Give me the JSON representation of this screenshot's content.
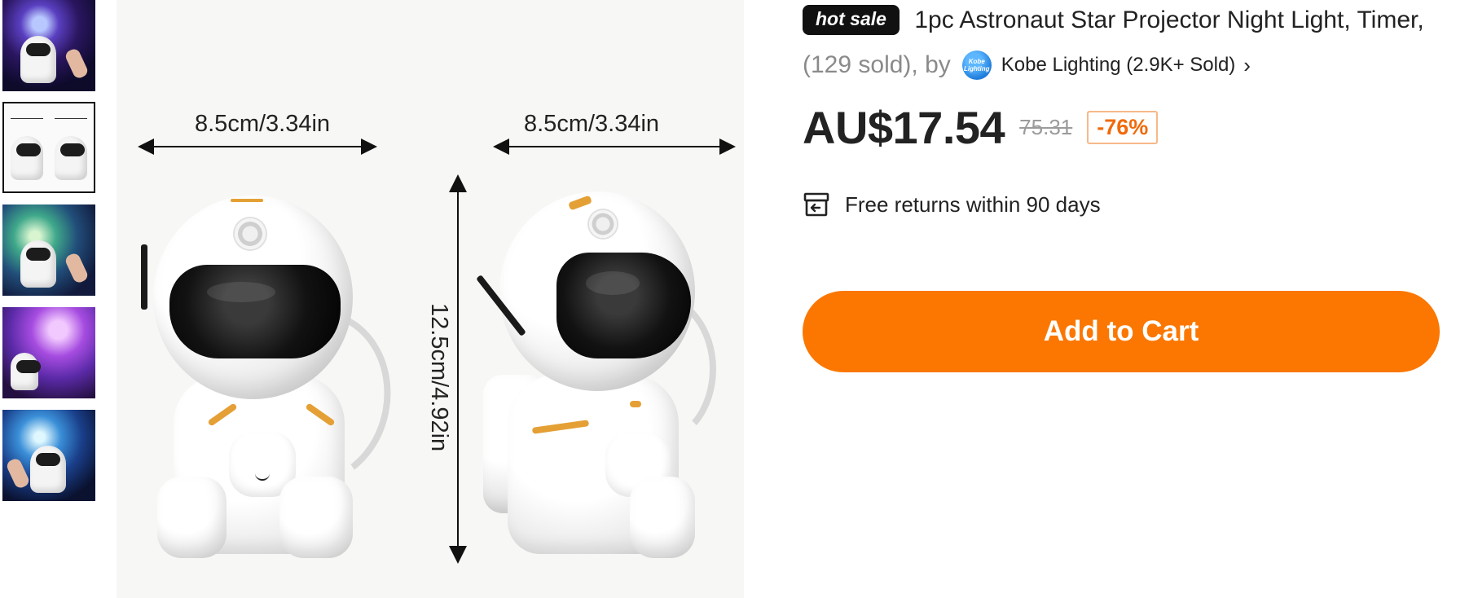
{
  "thumbnails": [
    {
      "icon": "astronaut-projector-blue-nebula"
    },
    {
      "icon": "astronaut-dimensions"
    },
    {
      "icon": "astronaut-projector-green-nebula"
    },
    {
      "icon": "astronaut-projector-purple-nebula"
    },
    {
      "icon": "astronaut-projector-blue-galaxy"
    }
  ],
  "main_image": {
    "width_label_left": "8.5cm/3.34in",
    "width_label_right": "8.5cm/3.34in",
    "height_label": "12.5cm/4.92in"
  },
  "product": {
    "badge": "hot sale",
    "title": "1pc Astronaut Star Projector Night Light, Timer,",
    "sold_count": "(129 sold), by",
    "seller_logo_text": "Kobe Lighting",
    "seller_name": "Kobe Lighting (2.9K+ Sold)",
    "price": "AU$17.54",
    "old_price": "75.31",
    "discount": "-76%",
    "returns": "Free returns within 90 days",
    "add_to_cart": "Add to Cart"
  },
  "colors": {
    "accent": "#fb7701",
    "discount_text": "#f06a0a",
    "badge_bg": "#111111",
    "seller_logo": "#1e7ddb"
  }
}
